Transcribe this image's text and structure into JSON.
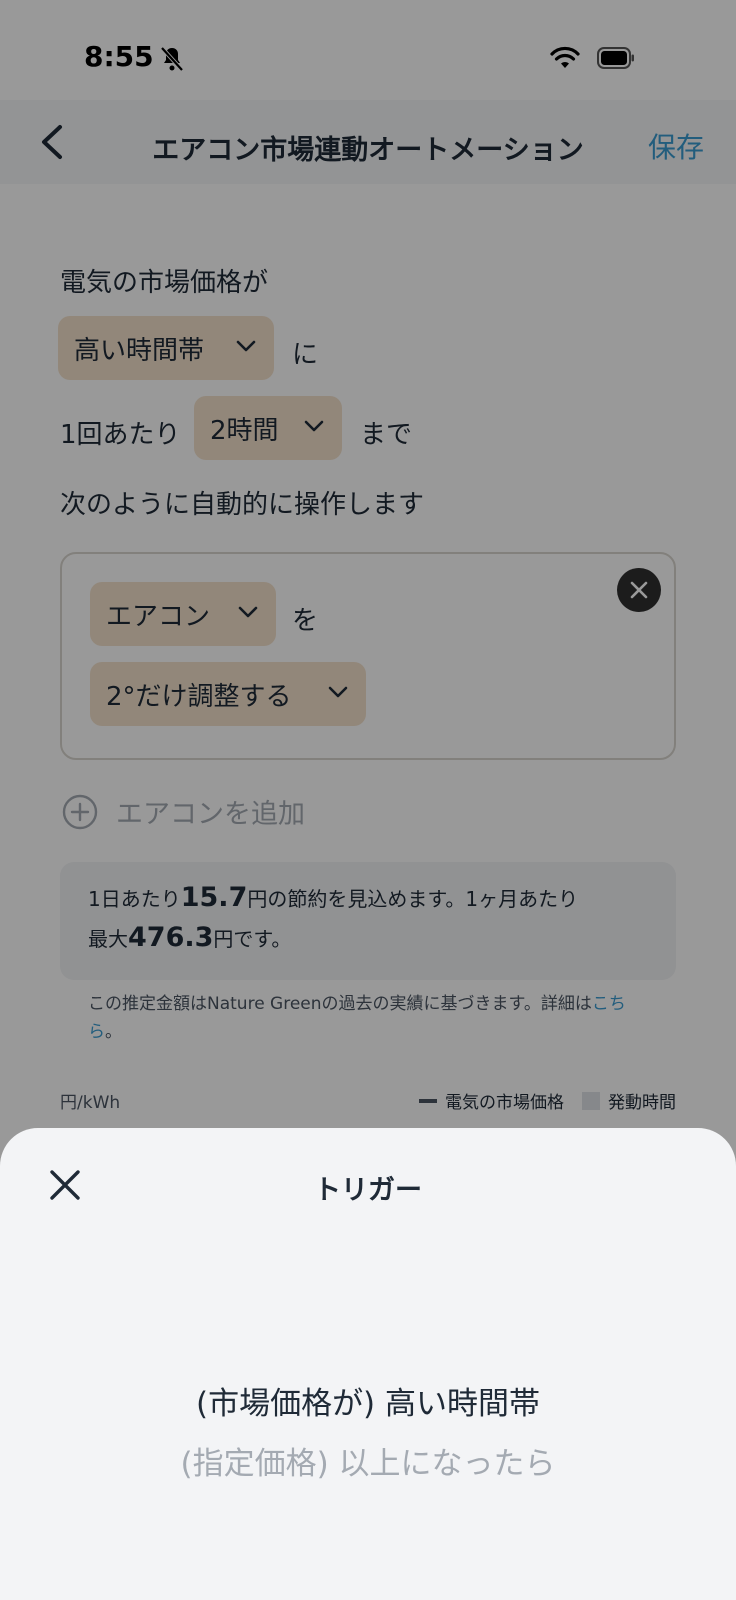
{
  "status_bar": {
    "time": "8:55"
  },
  "header": {
    "title": "エアコン市場連動オートメーション",
    "save_label": "保存"
  },
  "rule": {
    "line1": "電気の市場価格が",
    "trigger_value": "高い時間帯",
    "particle_ni": "に",
    "duration_prefix": "1回あたり",
    "duration_value": "2時間",
    "duration_suffix": "まで",
    "line4": "次のように自動的に操作します"
  },
  "action": {
    "device_value": "エアコン",
    "particle_wo": "を",
    "operation_value": "2°だけ調整する"
  },
  "add_button_label": "エアコンを追加",
  "savings": {
    "daily_prefix": "1日あたり",
    "daily_amount": "15.7",
    "daily_suffix": "円の節約を見込めます。1ヶ月あたり",
    "monthly_prefix": "最大",
    "monthly_amount": "476.3",
    "monthly_suffix": "円です。"
  },
  "note": {
    "text": "この推定金額はNature Greenの過去の実績に基づきます。詳細は",
    "link": "こちら",
    "end": "。"
  },
  "chart_header": {
    "unit": "円/kWh",
    "legend_price": "電気の市場価格",
    "legend_active": "発動時間"
  },
  "sheet": {
    "title": "トリガー",
    "options": [
      "(市場価格が) 高い時間帯",
      "(指定価格) 以上になったら"
    ],
    "selected_index": 0
  },
  "colors": {
    "accent": "#3a9bd1",
    "chip": "#f4e2cc",
    "sheet_bg": "#f3f4f6"
  },
  "icons": [
    "bell-slash-icon",
    "wifi-icon",
    "battery-icon",
    "back-chevron-icon",
    "chevron-down-icon",
    "close-circle-icon",
    "plus-circle-icon",
    "close-icon"
  ]
}
